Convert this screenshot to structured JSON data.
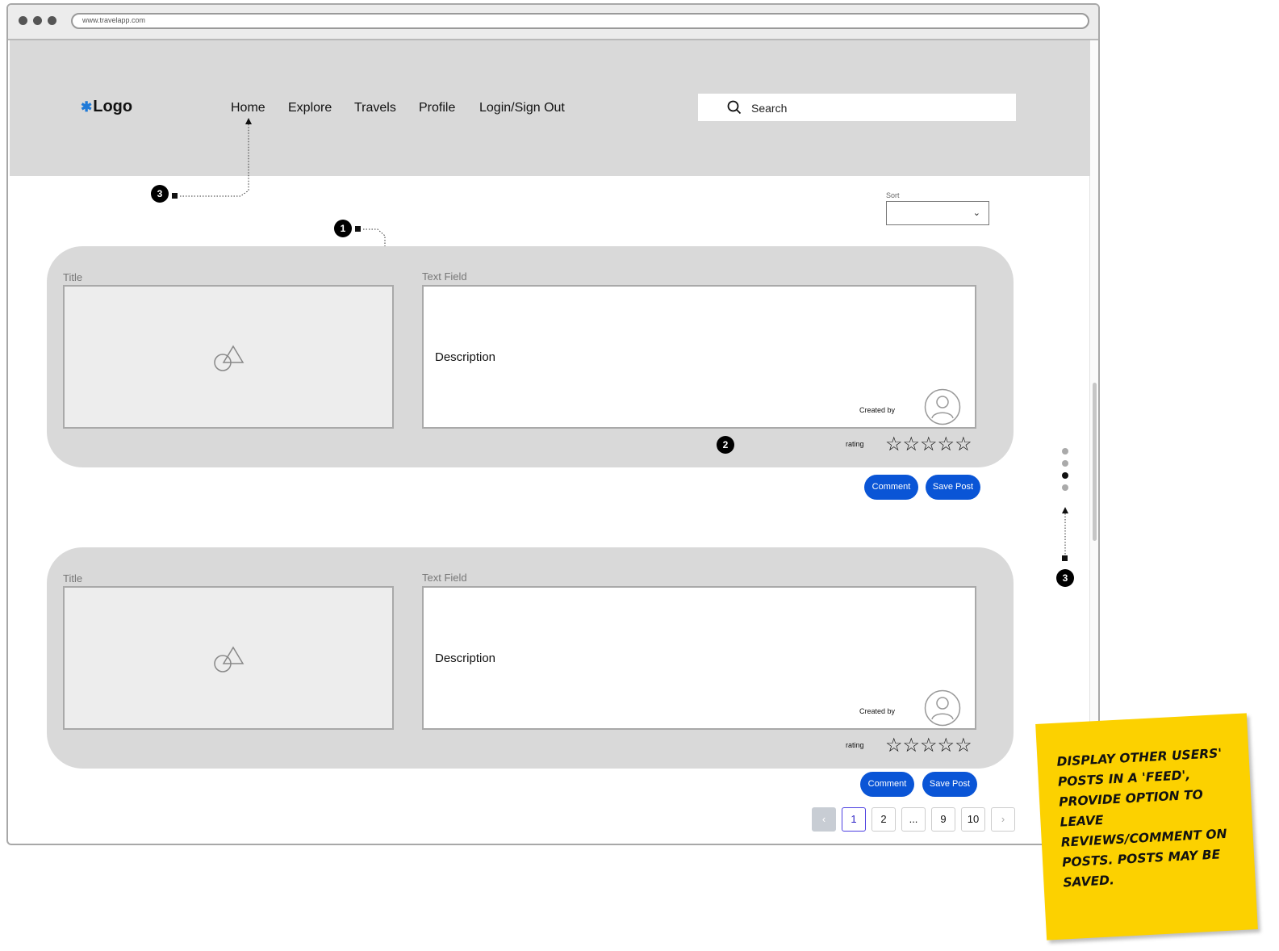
{
  "browser": {
    "url": "www.travelapp.com"
  },
  "header": {
    "logo": "Logo",
    "nav": [
      "Home",
      "Explore",
      "Travels",
      "Profile",
      "Login/Sign Out"
    ],
    "search_placeholder": "Search"
  },
  "sort": {
    "label": "Sort",
    "value": ""
  },
  "posts": [
    {
      "title_label": "Title",
      "text_label": "Text Field",
      "description": "Description",
      "created_by": "Created by",
      "rating_label": "rating",
      "rating": 0,
      "comment": "Comment",
      "save": "Save Post"
    },
    {
      "title_label": "Title",
      "text_label": "Text Field",
      "description": "Description",
      "created_by": "Created by",
      "rating_label": "rating",
      "rating": 0,
      "comment": "Comment",
      "save": "Save Post"
    }
  ],
  "pagination": {
    "pages": [
      "1",
      "2",
      "...",
      "9",
      "10"
    ],
    "current": "1"
  },
  "annotations": {
    "badge_1": "1",
    "badge_2": "2",
    "badge_3": "3"
  },
  "carousel": {
    "count": 4,
    "active_index": 2
  },
  "sticky_note": "Display other users' posts in a 'feed', provide option to leave reviews/comment on posts. Posts may be saved.",
  "colors": {
    "primary_button": "#0a55d6",
    "header_bg": "#d9d9d9",
    "sticky": "#fcd100",
    "logo_star": "#1f7ad8"
  }
}
